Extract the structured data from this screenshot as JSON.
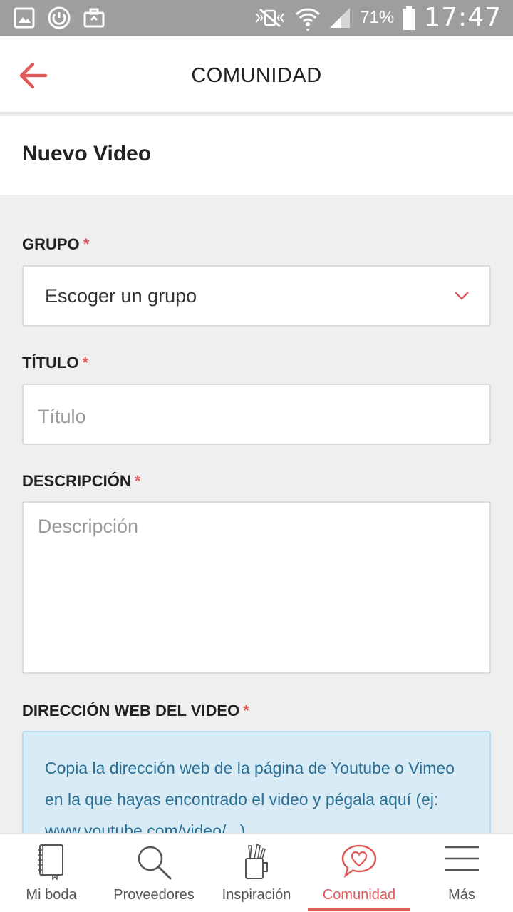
{
  "status_bar": {
    "battery_percent": "71%",
    "time": "17:47"
  },
  "app_bar": {
    "title": "COMUNIDAD"
  },
  "page": {
    "title": "Nuevo Video"
  },
  "form": {
    "group": {
      "label": "GRUPO",
      "required_mark": "*",
      "selected": "Escoger un grupo"
    },
    "title": {
      "label": "TÍTULO",
      "required_mark": "*",
      "placeholder": "Título"
    },
    "description": {
      "label": "DESCRIPCIÓN",
      "required_mark": "*",
      "placeholder": "Descripción"
    },
    "video_url": {
      "label": "DIRECCIÓN WEB DEL VIDEO",
      "required_mark": "*",
      "info": "Copia la dirección web de la página de Youtube o Vimeo en la que hayas encontrado el video y pégala aquí (ej: www.youtube.com/video/...)"
    }
  },
  "bottom_nav": {
    "items": [
      {
        "label": "Mi boda",
        "icon": "notebook-icon"
      },
      {
        "label": "Proveedores",
        "icon": "search-icon"
      },
      {
        "label": "Inspiración",
        "icon": "pencil-cup-icon"
      },
      {
        "label": "Comunidad",
        "icon": "heart-chat-icon",
        "active": true
      },
      {
        "label": "Más",
        "icon": "menu-icon"
      }
    ]
  },
  "colors": {
    "accent": "#e05a5a",
    "info_bg": "#d9ecf6",
    "info_text": "#2a6f95",
    "status_bar": "#9e9e9e"
  }
}
